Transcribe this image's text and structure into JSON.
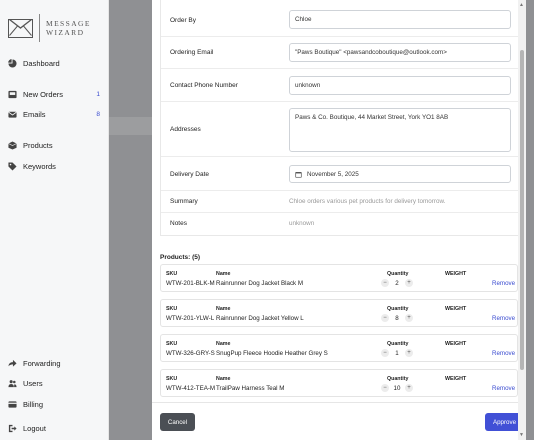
{
  "app": {
    "logo_text_line1": "MESSAGE",
    "logo_text_line2": "WIZARD"
  },
  "sidebar": {
    "items": [
      {
        "label": "Dashboard",
        "icon": "pie-chart-icon",
        "badge": ""
      },
      {
        "label": "New Orders",
        "icon": "inbox-icon",
        "badge": "1"
      },
      {
        "label": "Emails",
        "icon": "envelope-icon",
        "badge": "8"
      },
      {
        "label": "Products",
        "icon": "box-icon",
        "badge": ""
      },
      {
        "label": "Keywords",
        "icon": "tag-icon",
        "badge": ""
      },
      {
        "label": "Forwarding",
        "icon": "forward-arrow-icon",
        "badge": ""
      },
      {
        "label": "Users",
        "icon": "users-icon",
        "badge": ""
      },
      {
        "label": "Billing",
        "icon": "credit-card-icon",
        "badge": ""
      },
      {
        "label": "Logout",
        "icon": "logout-icon",
        "badge": ""
      }
    ]
  },
  "order": {
    "order_by_label": "Order By",
    "order_by_value": "Chloe",
    "email_label": "Ordering Email",
    "email_value": "\"Paws Boutique\" <pawsandcoboutique@outlook.com>",
    "phone_label": "Contact Phone Number",
    "phone_value": "unknown",
    "address_label": "Addresses",
    "address_value": "Paws & Co. Boutique, 44 Market Street, York YO1 8AB",
    "delivery_label": "Delivery Date",
    "delivery_value": "November 5, 2025",
    "summary_label": "Summary",
    "summary_value": "Chloe orders various pet products for delivery tomorrow.",
    "notes_label": "Notes",
    "notes_value": "unknown"
  },
  "products": {
    "title": "Products: (5)",
    "headers": {
      "sku": "SKU",
      "name": "Name",
      "quantity": "Quantity",
      "weight": "WEIGHT"
    },
    "remove_label": "Remove",
    "items": [
      {
        "sku": "WTW-201-BLK-M",
        "name": "Rainrunner Dog Jacket Black M",
        "qty": "2"
      },
      {
        "sku": "WTW-201-YLW-L",
        "name": "Rainrunner Dog Jacket Yellow L",
        "qty": "8"
      },
      {
        "sku": "WTW-326-GRY-S",
        "name": "SnugPup Fleece Hoodie Heather Grey S",
        "qty": "1"
      },
      {
        "sku": "WTW-412-TEA-M",
        "name": "TrailPaw Harness Teal M",
        "qty": "10"
      }
    ]
  },
  "footer": {
    "cancel_label": "Cancel",
    "approve_label": "Approve"
  },
  "colors": {
    "accent": "#4150d6",
    "cancel": "#4b4f55",
    "link": "#3b4cd0"
  }
}
